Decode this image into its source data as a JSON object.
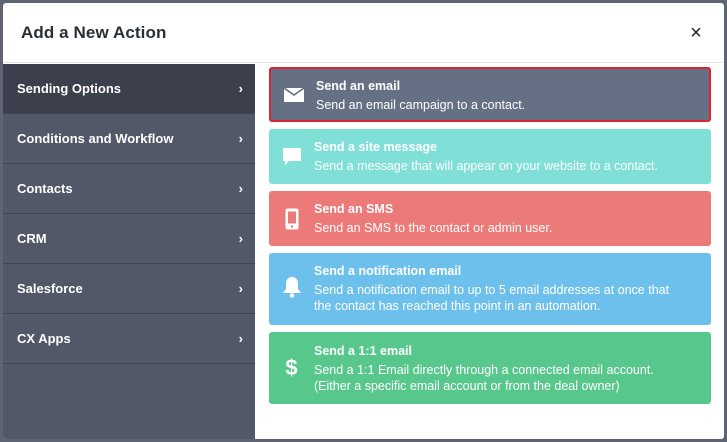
{
  "modal": {
    "title": "Add a New Action",
    "close_label": "×"
  },
  "sidebar": {
    "items": [
      {
        "label": "Sending Options",
        "active": true
      },
      {
        "label": "Conditions and Workflow"
      },
      {
        "label": "Contacts"
      },
      {
        "label": "CRM"
      },
      {
        "label": "Salesforce"
      },
      {
        "label": "CX Apps"
      }
    ],
    "chevron": "›"
  },
  "actions": [
    {
      "title": "Send an email",
      "description": "Send an email campaign to a contact.",
      "icon": "envelope-icon",
      "color": "#657085",
      "selected": true
    },
    {
      "title": "Send a site message",
      "description": "Send a message that will appear on your website to a contact.",
      "icon": "chat-bubble-icon",
      "color": "#80e0d7"
    },
    {
      "title": "Send an SMS",
      "description": "Send an SMS to the contact or admin user.",
      "icon": "mobile-phone-icon",
      "color": "#ec7a79"
    },
    {
      "title": "Send a notification email",
      "description_line1": "Send a notification email to up to 5 email addresses at once that",
      "description_line2": "the contact has reached this point in an automation.",
      "icon": "bell-icon",
      "color": "#6ec0ec"
    },
    {
      "title": "Send a 1:1 email",
      "description_line1": "Send a 1:1 Email directly through a connected email account.",
      "description_line2": "(Either a specific email account or from the deal owner)",
      "icon": "dollar-icon",
      "dollar_glyph": "$",
      "color": "#57c78c"
    }
  ]
}
